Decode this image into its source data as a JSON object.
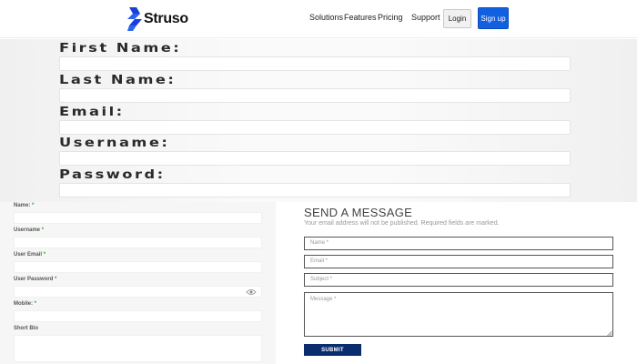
{
  "header": {
    "brand": "Struso",
    "nav": [
      "Solutions",
      "Features",
      "Pricing",
      "Support"
    ],
    "login_label": "Login",
    "signup_label": "Sign up"
  },
  "top_form": {
    "fields": [
      "First Name:",
      "Last Name:",
      "Email:",
      "Username:",
      "Password:"
    ]
  },
  "profile_form": {
    "name_label": "Name:",
    "username_label": "Username",
    "email_label": "User Email",
    "password_label": "User Password",
    "mobile_label": "Mobile:",
    "bio_label": "Short Bio",
    "required_mark": "*"
  },
  "contact": {
    "title": "SEND A MESSAGE",
    "subtitle": "Your email address will not be published. Required fields are marked.",
    "name_placeholder": "Name *",
    "email_placeholder": "Email *",
    "subject_placeholder": "Subject *",
    "message_placeholder": "Message *",
    "submit_label": "SUBMIT"
  },
  "colors": {
    "brand_blue": "#1160e2",
    "submit_navy": "#0a2d6e",
    "required_green": "#33aa33"
  }
}
